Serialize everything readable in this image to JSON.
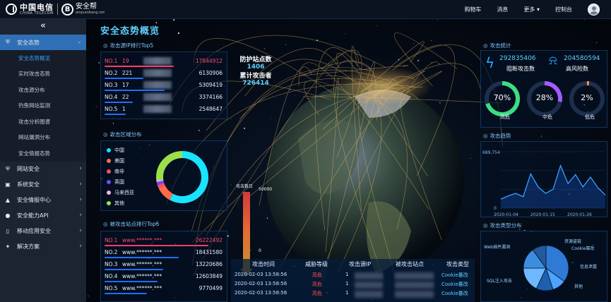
{
  "topbar": {
    "brand_cn": "中国电信",
    "brand_en": "CHINA TELECOM",
    "brand_b": "B",
    "product": "安全帮",
    "product_site": "anquanbang.net",
    "nav": [
      "购物车",
      "消息",
      "更多 ▾",
      "控制台"
    ]
  },
  "sidebar": {
    "collapse_icon": "«",
    "sections": [
      {
        "label": "安全态势",
        "icon": "shield-icon",
        "active": true
      },
      {
        "label": "网站安全",
        "icon": "shield-icon"
      },
      {
        "label": "系统安全",
        "icon": "cube-icon"
      },
      {
        "label": "安全情报中心",
        "icon": "warning-icon"
      },
      {
        "label": "安全能力API",
        "icon": "person-icon"
      },
      {
        "label": "移动应用安全",
        "icon": "mobile-icon"
      },
      {
        "label": "解决方案",
        "icon": "bulb-icon"
      }
    ],
    "subitems": [
      "安全态势概览",
      "实时攻击态势",
      "攻击源分布",
      "钓鱼网站监测",
      "攻击分析图谱",
      "网站漏洞分布",
      "安全情报态势"
    ]
  },
  "main": {
    "title": "安全态势概览",
    "ip_rank": {
      "title": "攻击源IP排行Top5",
      "rows": [
        {
          "n": "NO.1",
          "ip": "19",
          "v": "17844912",
          "pct": 0.98
        },
        {
          "n": "NO.2",
          "ip": "221",
          "v": "6130906",
          "pct": 0.55
        },
        {
          "n": "NO.3",
          "ip": "17",
          "v": "5309419",
          "pct": 0.85
        },
        {
          "n": "NO.4",
          "ip": "22",
          "v": "3374166",
          "pct": 0.4
        },
        {
          "n": "NO.5",
          "ip": "1",
          "v": "2548647",
          "pct": 0.3
        }
      ]
    },
    "region": {
      "title": "攻击区域分布",
      "legend": [
        {
          "name": "中国",
          "color": "#19e3ff"
        },
        {
          "name": "美国",
          "color": "#ff6b4a"
        },
        {
          "name": "南非",
          "color": "#ff4d6d"
        },
        {
          "name": "英国",
          "color": "#6a4dff"
        },
        {
          "name": "马来西亚",
          "color": "#ffb3e6"
        },
        {
          "name": "其他",
          "color": "#9be04a"
        }
      ]
    },
    "site_rank": {
      "title": "被攻击站点排行Top5",
      "rows": [
        {
          "n": "NO.1",
          "site": "www.******.***",
          "v": "26222492",
          "pct": 0.98
        },
        {
          "n": "NO.2",
          "site": "www.******.***",
          "v": "18431580",
          "pct": 0.7
        },
        {
          "n": "NO.3",
          "site": "www.******.***",
          "v": "13220686",
          "pct": 0.55
        },
        {
          "n": "NO.4",
          "site": "www.******.***",
          "v": "12603849",
          "pct": 0.5
        },
        {
          "n": "NO.5",
          "site": "www.******.***",
          "v": "9770499",
          "pct": 0.4
        }
      ]
    },
    "center": {
      "protect_label": "防护站点数",
      "protect_value": "1406",
      "attacker_label": "累计攻击者",
      "attacker_value": "726414",
      "thermo_label": "攻击数日",
      "thermo_max": "50000",
      "thermo_min": "0"
    },
    "table": {
      "headers": [
        "攻击时间",
        "威胁等级",
        "攻击源IP",
        "被攻击站点",
        "攻击类型"
      ],
      "rows": [
        {
          "time": "2020-02-03 13:58:56",
          "level": "高危",
          "ip": "1",
          "type": "Cookie篡改"
        },
        {
          "time": "2020-02-03 13:58:56",
          "level": "高危",
          "ip": "1",
          "type": "Cookie篡改"
        },
        {
          "time": "2020-02-03 13:58:56",
          "level": "高危",
          "ip": "1",
          "type": "Cookie篡改"
        }
      ]
    },
    "attack_stats": {
      "title": "攻击统计",
      "blocked_value": "292835406",
      "blocked_label": "阻断攻击数",
      "high_value": "204580594",
      "high_label": "高风险数",
      "rings": [
        {
          "pct": "70%",
          "label": "高危",
          "color": "#3ddc84",
          "frac": 0.7
        },
        {
          "pct": "28%",
          "label": "中危",
          "color": "#a65bff",
          "frac": 0.28
        },
        {
          "pct": "2%",
          "label": "低危",
          "color": "#ff9a4a",
          "frac": 0.02
        }
      ]
    },
    "trend": {
      "title": "攻击趋势",
      "y_ticks": [
        "689,754",
        "0"
      ],
      "x_ticks": [
        "2020-01-04",
        "2020-01-15",
        "2020-01-26"
      ]
    },
    "types": {
      "title": "攻击类型分布",
      "labels": [
        "Web插件漏洞",
        "资源盗链",
        "Cookie篡改",
        "信息泄露",
        "SQL注入攻击",
        "其他"
      ]
    }
  },
  "chart_data": [
    {
      "type": "line",
      "title": "攻击趋势",
      "x": [
        "2020-01-04",
        "2020-01-06",
        "2020-01-08",
        "2020-01-10",
        "2020-01-12",
        "2020-01-14",
        "2020-01-15",
        "2020-01-16",
        "2020-01-18",
        "2020-01-20",
        "2020-01-22",
        "2020-01-24",
        "2020-01-26",
        "2020-01-28",
        "2020-01-30"
      ],
      "values": [
        110000,
        150000,
        180000,
        140000,
        420000,
        260000,
        180000,
        230000,
        520000,
        300000,
        410000,
        260000,
        380000,
        250000,
        160000
      ],
      "ylim": [
        0,
        689754
      ]
    },
    {
      "type": "pie",
      "title": "攻击区域分布",
      "labels": [
        "中国",
        "美国",
        "南非",
        "英国",
        "马来西亚",
        "其他"
      ],
      "values": [
        58,
        10,
        2,
        2,
        1,
        27
      ]
    },
    {
      "type": "pie",
      "title": "攻击类型分布",
      "labels": [
        "Web插件漏洞",
        "资源盗链",
        "Cookie篡改",
        "信息泄露",
        "SQL注入攻击",
        "其他"
      ],
      "values": [
        35,
        10,
        12,
        18,
        15,
        10
      ]
    }
  ]
}
